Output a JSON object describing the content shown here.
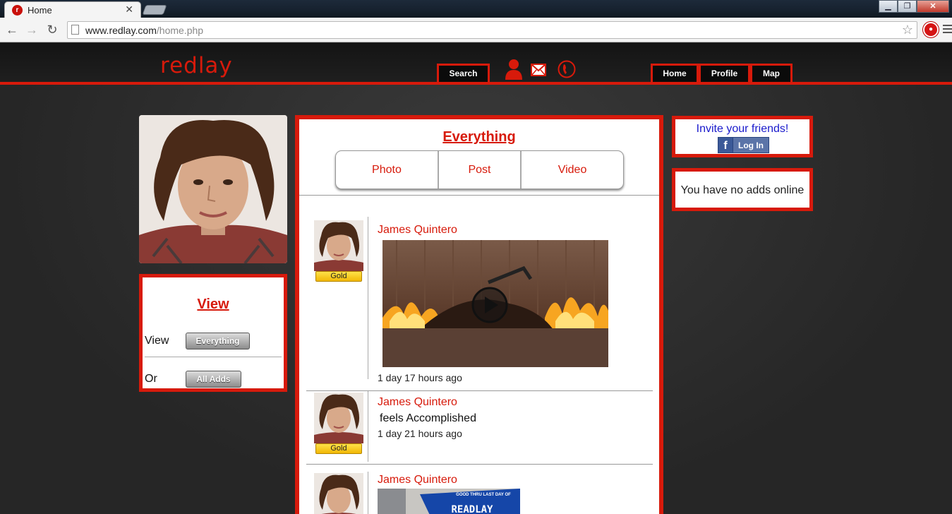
{
  "browser": {
    "tab_title": "Home",
    "favicon_letter": "r",
    "url_domain": "www.redlay.com",
    "url_path": "/home.php"
  },
  "header": {
    "logo": "redlay",
    "search_label": "Search",
    "nav": {
      "home": "Home",
      "profile": "Profile",
      "map": "Map"
    },
    "icons": [
      "person-icon",
      "mail-icon",
      "phone-icon"
    ]
  },
  "view_panel": {
    "title": "View",
    "row1_label": "View",
    "row1_button": "Everything",
    "row2_label": "Or",
    "row2_button": "All Adds"
  },
  "feed": {
    "title": "Everything",
    "tabs": [
      "Photo",
      "Post",
      "Video"
    ],
    "posts": [
      {
        "author": "James Quintero",
        "badge": "Gold",
        "type": "video",
        "time": "1 day 17 hours ago"
      },
      {
        "author": "James Quintero",
        "badge": "Gold",
        "type": "status",
        "text": "feels Accomplished",
        "time": "1 day 21 hours ago"
      },
      {
        "author": "James Quintero",
        "type": "photo",
        "image_text": "READLAY",
        "image_caption": "GOOD THRU LAST DAY OF"
      }
    ]
  },
  "sidebar_right": {
    "invite_text": "Invite your friends!",
    "fb_login_label": "Log In",
    "no_adds_text": "You have no adds online"
  },
  "colors": {
    "brand_red": "#d71a0b",
    "badge_gold": "#f2b705",
    "link_blue": "#1a1acc"
  }
}
